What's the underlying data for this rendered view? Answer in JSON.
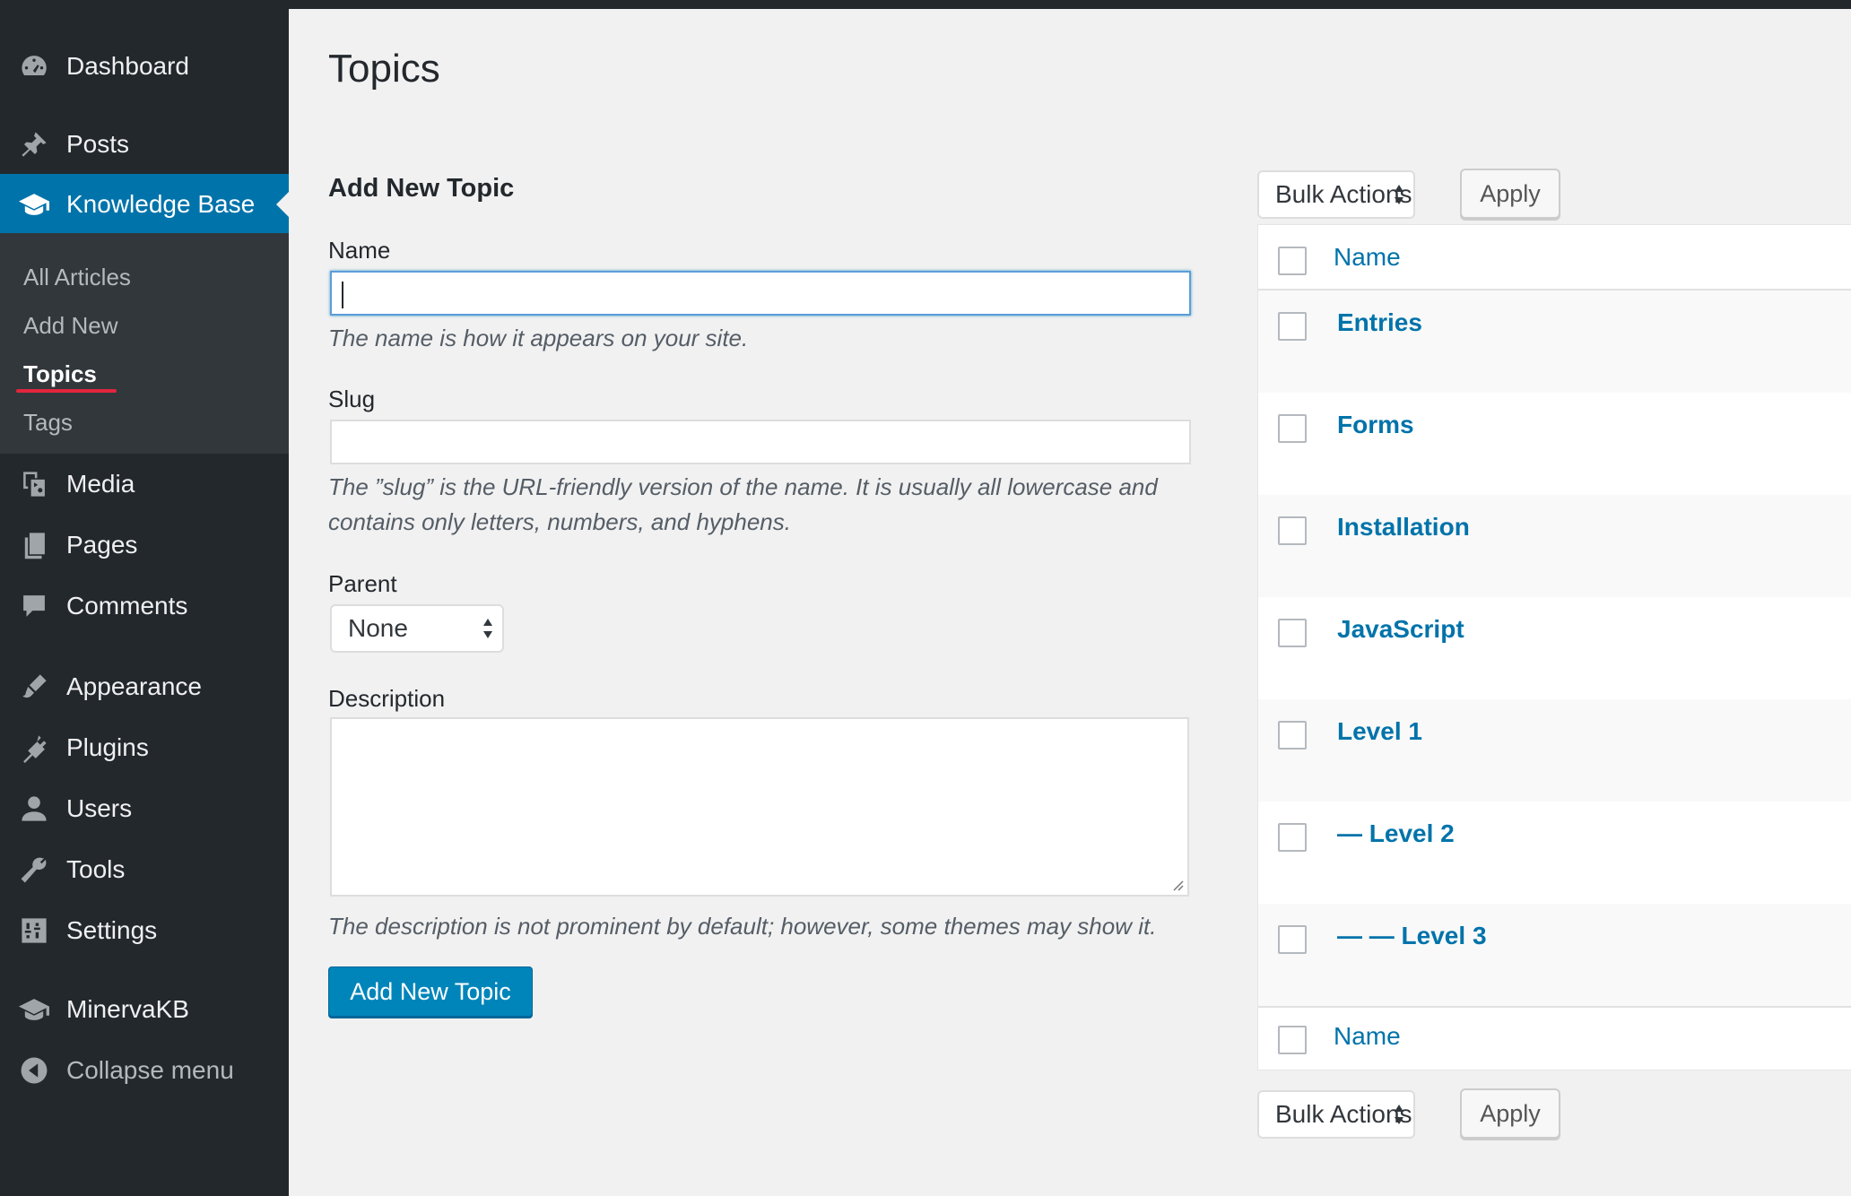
{
  "sidebar": {
    "top_items": [
      {
        "label": "Dashboard",
        "icon": "dashboard-icon"
      },
      {
        "label": "Posts",
        "icon": "pin-icon"
      },
      {
        "label": "Knowledge Base",
        "icon": "graduation-cap-icon"
      }
    ],
    "submenu": [
      {
        "label": "All Articles"
      },
      {
        "label": "Add New"
      },
      {
        "label": "Topics"
      },
      {
        "label": "Tags"
      }
    ],
    "bottom_items": [
      {
        "label": "Media",
        "icon": "media-icon"
      },
      {
        "label": "Pages",
        "icon": "pages-icon"
      },
      {
        "label": "Comments",
        "icon": "comment-icon"
      },
      {
        "label": "Appearance",
        "icon": "brush-icon"
      },
      {
        "label": "Plugins",
        "icon": "plugin-icon"
      },
      {
        "label": "Users",
        "icon": "user-icon"
      },
      {
        "label": "Tools",
        "icon": "wrench-icon"
      },
      {
        "label": "Settings",
        "icon": "settings-icon"
      },
      {
        "label": "MinervaKB",
        "icon": "graduation-cap-icon"
      },
      {
        "label": "Collapse menu",
        "icon": "collapse-icon"
      }
    ]
  },
  "page": {
    "title": "Topics"
  },
  "form": {
    "heading": "Add New Topic",
    "name_label": "Name",
    "name_value": "",
    "name_hint": "The name is how it appears on your site.",
    "slug_label": "Slug",
    "slug_value": "",
    "slug_hint_line1": "The ”slug” is the URL-friendly version of the name. It is usually all lowercase and",
    "slug_hint_line2": "contains only letters, numbers, and hyphens.",
    "parent_label": "Parent",
    "parent_selected": "None",
    "description_label": "Description",
    "description_hint": "The description is not prominent by default; however, some themes may show it.",
    "submit_label": "Add New Topic"
  },
  "list": {
    "bulk_actions_label": "Bulk Actions",
    "apply_label": "Apply",
    "column_name": "Name",
    "terms": [
      "Entries",
      "Forms",
      "Installation",
      "JavaScript",
      "Level 1",
      "— Level 2",
      "— — Level 3"
    ]
  },
  "colors": {
    "sidebar_bg": "#23282d",
    "submenu_bg": "#32373c",
    "active_blue": "#0073aa",
    "primary_button": "#0085ba",
    "link_blue": "#0073aa",
    "underline_red": "#e2253d"
  }
}
